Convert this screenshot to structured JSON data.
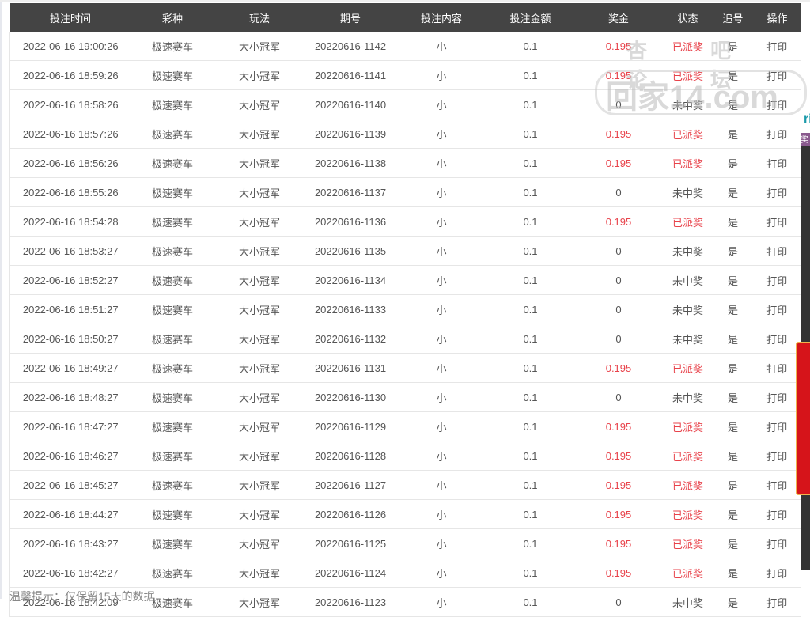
{
  "columns": [
    "投注时间",
    "彩种",
    "玩法",
    "期号",
    "投注内容",
    "投注金额",
    "奖金",
    "状态",
    "追号",
    "操作"
  ],
  "rows": [
    [
      "2022-06-16 19:00:26",
      "极速赛车",
      "大小冠军",
      "20220616-1142",
      "小",
      "0.1",
      "0.195",
      "已派奖",
      "是",
      "打印"
    ],
    [
      "2022-06-16 18:59:26",
      "极速赛车",
      "大小冠军",
      "20220616-1141",
      "小",
      "0.1",
      "0.195",
      "已派奖",
      "是",
      "打印"
    ],
    [
      "2022-06-16 18:58:26",
      "极速赛车",
      "大小冠军",
      "20220616-1140",
      "小",
      "0.1",
      "0",
      "未中奖",
      "是",
      "打印"
    ],
    [
      "2022-06-16 18:57:26",
      "极速赛车",
      "大小冠军",
      "20220616-1139",
      "小",
      "0.1",
      "0.195",
      "已派奖",
      "是",
      "打印"
    ],
    [
      "2022-06-16 18:56:26",
      "极速赛车",
      "大小冠军",
      "20220616-1138",
      "小",
      "0.1",
      "0.195",
      "已派奖",
      "是",
      "打印"
    ],
    [
      "2022-06-16 18:55:26",
      "极速赛车",
      "大小冠军",
      "20220616-1137",
      "小",
      "0.1",
      "0",
      "未中奖",
      "是",
      "打印"
    ],
    [
      "2022-06-16 18:54:28",
      "极速赛车",
      "大小冠军",
      "20220616-1136",
      "小",
      "0.1",
      "0.195",
      "已派奖",
      "是",
      "打印"
    ],
    [
      "2022-06-16 18:53:27",
      "极速赛车",
      "大小冠军",
      "20220616-1135",
      "小",
      "0.1",
      "0",
      "未中奖",
      "是",
      "打印"
    ],
    [
      "2022-06-16 18:52:27",
      "极速赛车",
      "大小冠军",
      "20220616-1134",
      "小",
      "0.1",
      "0",
      "未中奖",
      "是",
      "打印"
    ],
    [
      "2022-06-16 18:51:27",
      "极速赛车",
      "大小冠军",
      "20220616-1133",
      "小",
      "0.1",
      "0",
      "未中奖",
      "是",
      "打印"
    ],
    [
      "2022-06-16 18:50:27",
      "极速赛车",
      "大小冠军",
      "20220616-1132",
      "小",
      "0.1",
      "0",
      "未中奖",
      "是",
      "打印"
    ],
    [
      "2022-06-16 18:49:27",
      "极速赛车",
      "大小冠军",
      "20220616-1131",
      "小",
      "0.1",
      "0.195",
      "已派奖",
      "是",
      "打印"
    ],
    [
      "2022-06-16 18:48:27",
      "极速赛车",
      "大小冠军",
      "20220616-1130",
      "小",
      "0.1",
      "0",
      "未中奖",
      "是",
      "打印"
    ],
    [
      "2022-06-16 18:47:27",
      "极速赛车",
      "大小冠军",
      "20220616-1129",
      "小",
      "0.1",
      "0.195",
      "已派奖",
      "是",
      "打印"
    ],
    [
      "2022-06-16 18:46:27",
      "极速赛车",
      "大小冠军",
      "20220616-1128",
      "小",
      "0.1",
      "0.195",
      "已派奖",
      "是",
      "打印"
    ],
    [
      "2022-06-16 18:45:27",
      "极速赛车",
      "大小冠军",
      "20220616-1127",
      "小",
      "0.1",
      "0.195",
      "已派奖",
      "是",
      "打印"
    ],
    [
      "2022-06-16 18:44:27",
      "极速赛车",
      "大小冠军",
      "20220616-1126",
      "小",
      "0.1",
      "0.195",
      "已派奖",
      "是",
      "打印"
    ],
    [
      "2022-06-16 18:43:27",
      "极速赛车",
      "大小冠军",
      "20220616-1125",
      "小",
      "0.1",
      "0.195",
      "已派奖",
      "是",
      "打印"
    ],
    [
      "2022-06-16 18:42:27",
      "极速赛车",
      "大小冠军",
      "20220616-1124",
      "小",
      "0.1",
      "0.195",
      "已派奖",
      "是",
      "打印"
    ],
    [
      "2022-06-16 18:42:09",
      "极速赛车",
      "大小冠军",
      "20220616-1123",
      "小",
      "0.1",
      "0",
      "未中奖",
      "是",
      "打印"
    ]
  ],
  "footer": "温馨提示：仅保留15天的数据",
  "watermark": {
    "top": "杏吧 论坛",
    "main": "回家14.com"
  },
  "side": {
    "text": "ri",
    "badge": "奖"
  },
  "colors": {
    "header_bg": "#444444",
    "win_red": "#e8434b"
  }
}
